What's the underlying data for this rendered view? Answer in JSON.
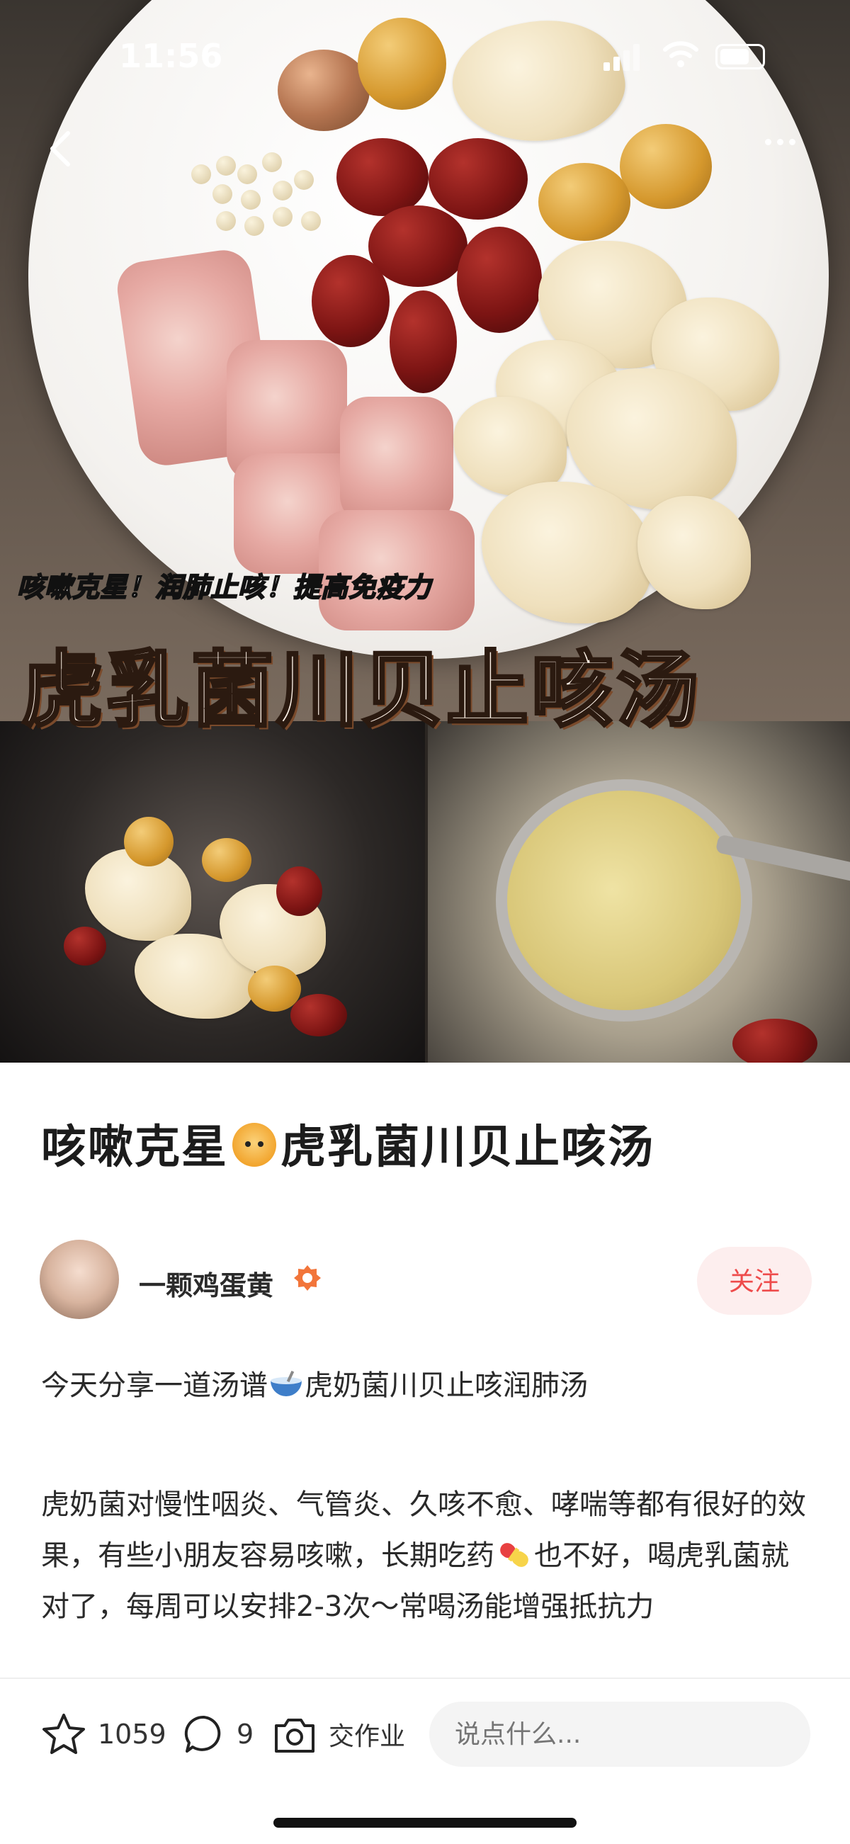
{
  "status_bar": {
    "time": "11:56"
  },
  "hero": {
    "overlay_subtitle": "咳嗽克星！润肺止咳！提高免疫力",
    "overlay_title": "虎乳菌川贝止咳汤"
  },
  "post": {
    "title_part1": "咳嗽克星",
    "title_part2": "虎乳菌川贝止咳汤",
    "author": {
      "name": "一颗鸡蛋黄",
      "follow_label": "关注"
    },
    "body": {
      "para1_a": "今天分享一道汤谱",
      "para1_b": "虎奶菌川贝止咳润肺汤",
      "para2_a": "虎奶菌对慢性咽炎、气管炎、久咳不愈、哮喘等都有很好的效果，有些小朋友容易咳嗽，长期吃药",
      "para2_b": "也不好，喝虎乳菌就对了，每周可以安排2-3次～",
      "para2_c": "常喝汤能增强抵抗力"
    }
  },
  "bottom_bar": {
    "like_count": "1059",
    "comment_count": "9",
    "homework_label": "交作业",
    "comment_placeholder": "说点什么..."
  },
  "colors": {
    "accent": "#ee4b4b",
    "follow_bg": "#fdeeee"
  }
}
